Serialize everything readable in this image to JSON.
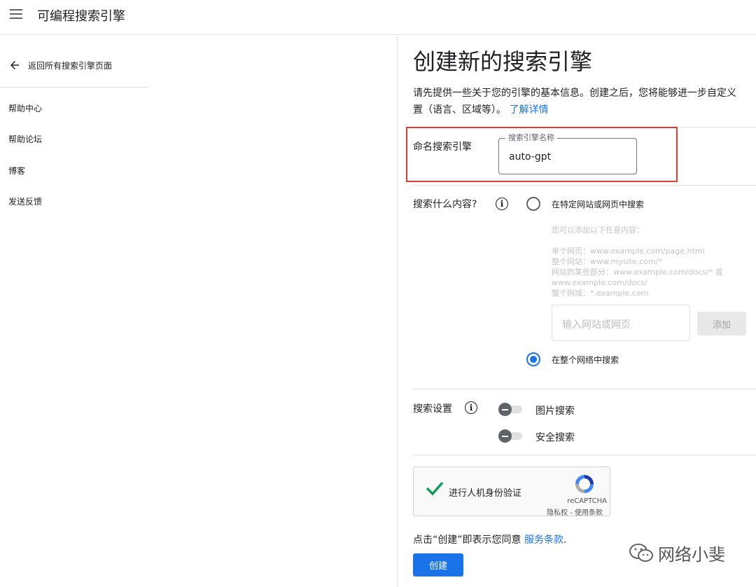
{
  "app": {
    "title": "可编程搜索引擎"
  },
  "sidebar": {
    "back_label": "返回所有搜索引擎页面",
    "items": [
      {
        "label": "帮助中心"
      },
      {
        "label": "帮助论坛"
      },
      {
        "label": "博客"
      },
      {
        "label": "发送反馈"
      }
    ]
  },
  "main": {
    "title": "创建新的搜索引擎",
    "intro_line1": "请先提供一些关于您的引擎的基本信息。创建之后，您将能够进一步自定义",
    "intro_line2": "置（语言、区域等）。",
    "learn_more": "了解详情",
    "name_section": {
      "label": "命名搜索引擎",
      "field_legend": "搜索引擎名称",
      "field_value": "auto-gpt"
    },
    "content_section": {
      "label": "搜索什么内容?",
      "option_specific": "在特定网站或网页中搜索",
      "hint_title": "您可以添加以下任意内容：",
      "hints": [
        "单个网页：www.example.com/page.html",
        "整个网站：www.mysite.com/*",
        "网站的某些部分：www.example.com/docs/* 或",
        "www.example.com/docs/",
        "整个网域：*.example.com"
      ],
      "site_placeholder": "输入网站或网页",
      "add_label": "添加",
      "option_web": "在整个网络中搜索",
      "selected": "web"
    },
    "settings_section": {
      "label": "搜索设置",
      "image_search": "图片搜索",
      "safe_search": "安全搜索"
    },
    "captcha": {
      "label": "进行人机身份验证",
      "brand": "reCAPTCHA",
      "terms": "隐私权 - 使用条款"
    },
    "agree_text": "点击“创建”即表示您同意",
    "terms_link": "服务条款",
    "agree_period": ".",
    "create_label": "创建"
  },
  "watermark": {
    "text": "网络小斐"
  },
  "colors": {
    "accent": "#1a73e8",
    "highlight_border": "#e53935"
  }
}
